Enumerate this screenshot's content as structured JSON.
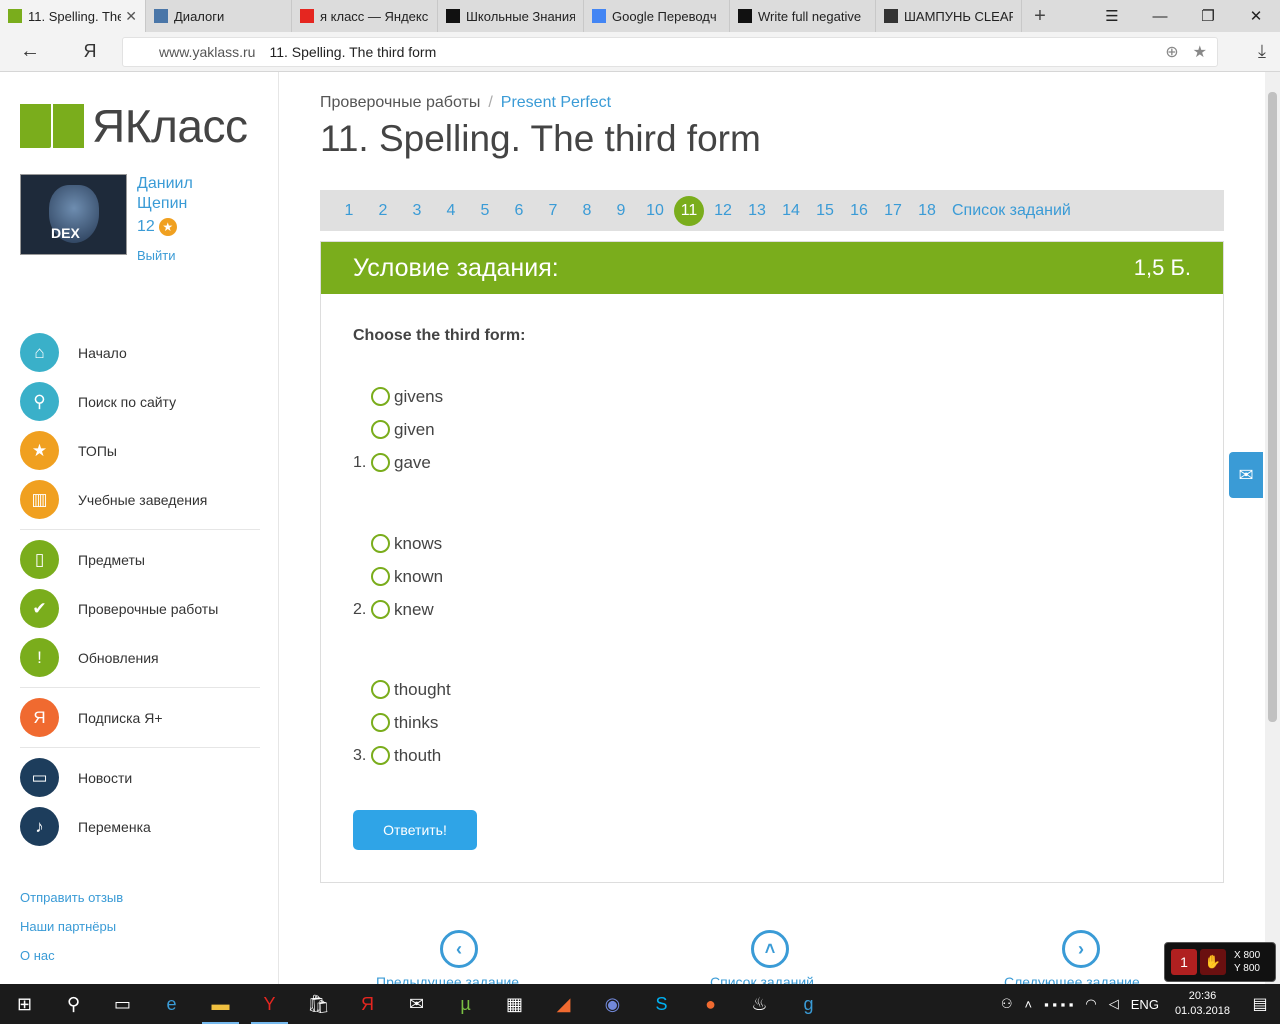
{
  "browser": {
    "tabs": [
      {
        "title": "11. Spelling. The",
        "favicon": "yaklass-icon",
        "active": true,
        "fav_color": "#7aad1c"
      },
      {
        "title": "Диалоги",
        "favicon": "chat-icon",
        "fav_color": "#4a76a8"
      },
      {
        "title": "я класс — Яндекс",
        "favicon": "yandex-icon",
        "fav_color": "#e52620"
      },
      {
        "title": "Школьные Знания",
        "favicon": "znanija-icon",
        "fav_color": "#111111"
      },
      {
        "title": "Google Переводч",
        "favicon": "google-translate-icon",
        "fav_color": "#4285f4"
      },
      {
        "title": "Write full negative",
        "favicon": "znanija-icon",
        "fav_color": "#111111"
      },
      {
        "title": "ШАМПУНЬ CLEAR",
        "favicon": "figure-icon",
        "fav_color": "#333333"
      }
    ],
    "url_host": "www.yaklass.ru",
    "url_title": "11. Spelling. The third form",
    "yandex_btn": "Я"
  },
  "sidebar": {
    "logo_text": "ЯКласс",
    "user": {
      "first_name": "Даниил",
      "last_name": "Щепин",
      "points": "12",
      "logout": "Выйти",
      "avatar_text": "DEX"
    },
    "menu": [
      {
        "label": "Начало",
        "icon": "home-icon",
        "color": "#3ab0c9"
      },
      {
        "label": "Поиск по сайту",
        "icon": "search-icon",
        "color": "#3ab0c9"
      },
      {
        "label": "ТОПы",
        "icon": "star-icon",
        "color": "#f0a020"
      },
      {
        "label": "Учебные заведения",
        "icon": "institution-icon",
        "color": "#f0a020"
      },
      {
        "label": "Предметы",
        "icon": "book-icon",
        "color": "#7aad1c"
      },
      {
        "label": "Проверочные работы",
        "icon": "check-icon",
        "color": "#7aad1c"
      },
      {
        "label": "Обновления",
        "icon": "exclamation-icon",
        "color": "#7aad1c"
      },
      {
        "label": "Подписка Я+",
        "icon": "ya-plus-icon",
        "color": "#f06a30"
      },
      {
        "label": "Новости",
        "icon": "message-icon",
        "color": "#1d3d5c"
      },
      {
        "label": "Переменка",
        "icon": "bell-icon",
        "color": "#1d3d5c"
      }
    ],
    "footer_links": [
      "Отправить отзыв",
      "Наши партнёры",
      "О нас"
    ]
  },
  "main": {
    "breadcrumb": {
      "root": "Проверочные работы",
      "current": "Present Perfect"
    },
    "title": "11. Spelling. The third form",
    "pager": {
      "pages": [
        "1",
        "2",
        "3",
        "4",
        "5",
        "6",
        "7",
        "8",
        "9",
        "10",
        "11",
        "12",
        "13",
        "14",
        "15",
        "16",
        "17",
        "18"
      ],
      "current": "11",
      "list_label": "Список заданий"
    },
    "task": {
      "header": "Условие задания:",
      "points": "1,5 Б.",
      "question": "Choose the third form:",
      "groups": [
        {
          "number": "1.",
          "options": [
            "givens",
            "given",
            "gave"
          ]
        },
        {
          "number": "2.",
          "options": [
            "knows",
            "known",
            "knew"
          ]
        },
        {
          "number": "3.",
          "options": [
            "thought",
            "thinks",
            "thouth"
          ]
        }
      ],
      "submit": "Ответить!"
    },
    "bottom_nav": {
      "prev": "Предыдущее задание",
      "list": "Список заданий",
      "next": "Следующее задание"
    }
  },
  "overlay": {
    "x": "X 800",
    "y": "Y 800"
  },
  "taskbar": {
    "lang": "ENG",
    "time": "20:36",
    "date": "01.03.2018"
  }
}
